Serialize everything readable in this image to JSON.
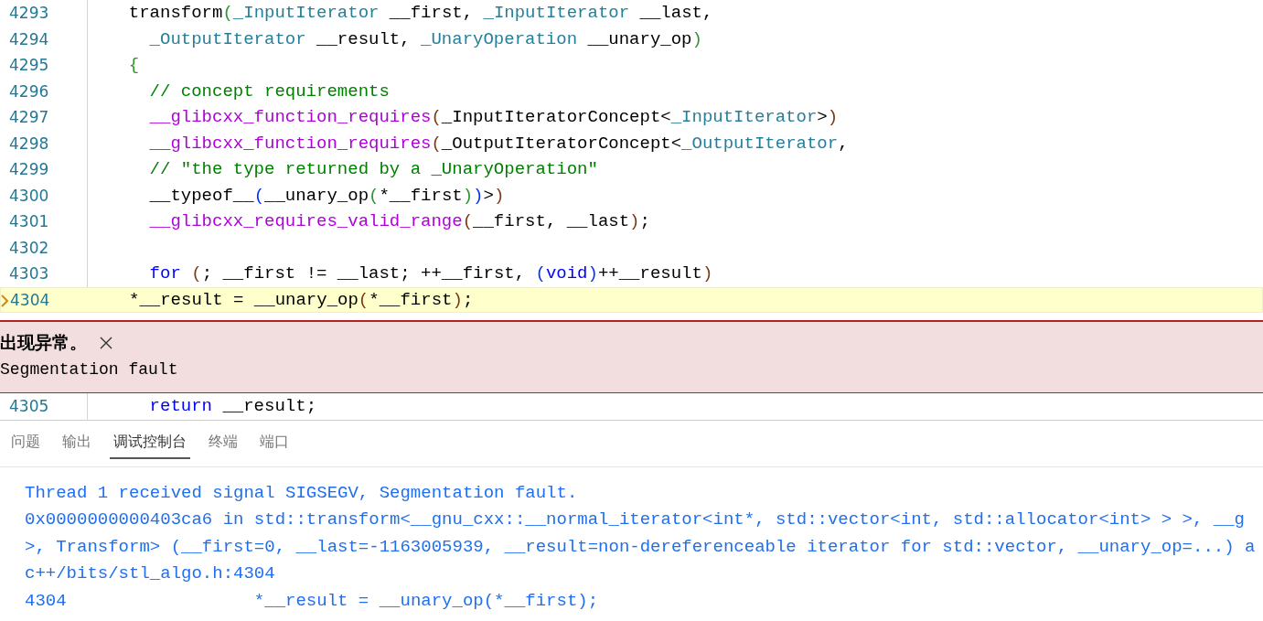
{
  "editor": {
    "lines": [
      {
        "number": "4293",
        "kind": "signature",
        "current": false,
        "tokens": [
          {
            "kind": "plain",
            "text": "transform"
          },
          {
            "kind": "b-green",
            "text": "("
          },
          {
            "kind": "type",
            "text": "_InputIterator"
          },
          {
            "kind": "plain",
            "text": " __first, "
          },
          {
            "kind": "type",
            "text": "_InputIterator"
          },
          {
            "kind": "plain",
            "text": " __last,"
          }
        ]
      },
      {
        "number": "4294",
        "kind": "continuation",
        "current": false,
        "tokens": [
          {
            "kind": "type",
            "text": "_OutputIterator"
          },
          {
            "kind": "plain",
            "text": " __result, "
          },
          {
            "kind": "type",
            "text": "_UnaryOperation"
          },
          {
            "kind": "plain",
            "text": " __unary_op"
          },
          {
            "kind": "b-green",
            "text": ")"
          }
        ]
      },
      {
        "number": "4295",
        "kind": "signature",
        "current": false,
        "tokens": [
          {
            "kind": "b-green",
            "text": "{"
          }
        ]
      },
      {
        "number": "4296",
        "kind": "body",
        "current": false,
        "tokens": [
          {
            "kind": "comment",
            "text": "// concept requirements"
          }
        ]
      },
      {
        "number": "4297",
        "kind": "body",
        "current": false,
        "tokens": [
          {
            "kind": "macro",
            "text": "__glibcxx_function_requires"
          },
          {
            "kind": "b-brown",
            "text": "("
          },
          {
            "kind": "plain",
            "text": "_InputIteratorConcept<"
          },
          {
            "kind": "type",
            "text": "_InputIterator"
          },
          {
            "kind": "plain",
            "text": ">"
          },
          {
            "kind": "b-brown",
            "text": ")"
          }
        ]
      },
      {
        "number": "4298",
        "kind": "body",
        "current": false,
        "tokens": [
          {
            "kind": "macro",
            "text": "__glibcxx_function_requires"
          },
          {
            "kind": "b-brown",
            "text": "("
          },
          {
            "kind": "plain",
            "text": "_OutputIteratorConcept<"
          },
          {
            "kind": "type",
            "text": "_OutputIterator"
          },
          {
            "kind": "plain",
            "text": ","
          }
        ]
      },
      {
        "number": "4299",
        "kind": "body",
        "current": false,
        "tokens": [
          {
            "kind": "comment",
            "text": "// \"the type returned by a _UnaryOperation\""
          }
        ]
      },
      {
        "number": "4300",
        "kind": "body",
        "current": false,
        "tokens": [
          {
            "kind": "plain",
            "text": "__typeof__"
          },
          {
            "kind": "b-blue",
            "text": "("
          },
          {
            "kind": "plain",
            "text": "__unary_op"
          },
          {
            "kind": "b-green",
            "text": "("
          },
          {
            "kind": "plain",
            "text": "*__first"
          },
          {
            "kind": "b-green",
            "text": ")"
          },
          {
            "kind": "b-blue",
            "text": ")"
          },
          {
            "kind": "plain",
            "text": ">"
          },
          {
            "kind": "b-brown",
            "text": ")"
          }
        ]
      },
      {
        "number": "4301",
        "kind": "body",
        "current": false,
        "tokens": [
          {
            "kind": "macro",
            "text": "__glibcxx_requires_valid_range"
          },
          {
            "kind": "b-brown",
            "text": "("
          },
          {
            "kind": "plain",
            "text": "__first, __last"
          },
          {
            "kind": "b-brown",
            "text": ")"
          },
          {
            "kind": "plain",
            "text": ";"
          }
        ]
      },
      {
        "number": "4302",
        "kind": "body",
        "current": false
      },
      {
        "number": "4303",
        "kind": "body",
        "current": false,
        "tokens": [
          {
            "kind": "keyword",
            "text": "for"
          },
          {
            "kind": "b-brown",
            "text": " ("
          },
          {
            "kind": "plain",
            "text": "; __first != __last; ++__first, "
          },
          {
            "kind": "b-blue",
            "text": "("
          },
          {
            "kind": "keyword",
            "text": "void"
          },
          {
            "kind": "b-blue",
            "text": ")"
          },
          {
            "kind": "plain",
            "text": "++__result"
          },
          {
            "kind": "b-brown",
            "text": ")"
          }
        ]
      },
      {
        "number": "4304",
        "kind": "flush",
        "current": true,
        "tokens": [
          {
            "kind": "plain",
            "text": "*__result = __unary_op"
          },
          {
            "kind": "b-brown",
            "text": "("
          },
          {
            "kind": "plain",
            "text": "*__first"
          },
          {
            "kind": "b-brown",
            "text": ")"
          },
          {
            "kind": "plain",
            "text": ";"
          }
        ]
      }
    ],
    "exception": {
      "title": "出现异常。",
      "message": "Segmentation fault"
    },
    "after_lines": [
      {
        "number": "4305",
        "kind": "body",
        "current": false,
        "tokens": [
          {
            "kind": "keyword",
            "text": "return"
          },
          {
            "kind": "plain",
            "text": " __result;"
          }
        ]
      }
    ]
  },
  "panel": {
    "tabs": [
      {
        "label": "问题",
        "selected": false
      },
      {
        "label": "输出",
        "selected": false
      },
      {
        "label": "调试控制台",
        "selected": true
      },
      {
        "label": "终端",
        "selected": false
      },
      {
        "label": "端口",
        "selected": false
      }
    ],
    "console": [
      "Thread 1 received signal SIGSEGV, Segmentation fault.",
      "0x0000000000403ca6 in std::transform<__gnu_cxx::__normal_iterator<int*, std::vector<int, std::allocator<int> > >, __g",
      ">, Transform> (__first=0, __last=-1163005939, __result=non-dereferenceable iterator for std::vector, __unary_op=...) a",
      "c++/bits/stl_algo.h:4304",
      "4304\t        *__result = __unary_op(*__first);"
    ]
  }
}
